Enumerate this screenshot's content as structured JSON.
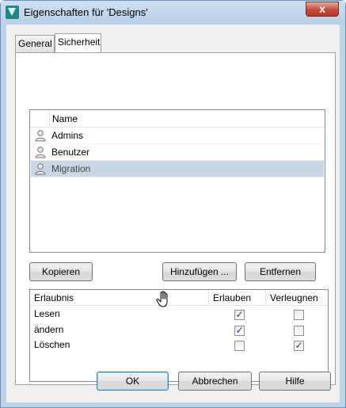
{
  "window": {
    "title": "Eigenschaften für 'Designs'",
    "close_glyph": "x"
  },
  "tabs": [
    {
      "label": "General",
      "active": false
    },
    {
      "label": "Sicherheit",
      "active": true
    }
  ],
  "users_list": {
    "column_header": "Name",
    "items": [
      {
        "label": "Admins",
        "selected": false,
        "icon": "user-icon"
      },
      {
        "label": "Benutzer",
        "selected": false,
        "icon": "user-icon"
      },
      {
        "label": "Migration",
        "selected": true,
        "icon": "user-icon"
      }
    ]
  },
  "list_buttons": {
    "copy": "Kopieren",
    "add": "Hinzufügen ...",
    "remove": "Entfernen"
  },
  "permissions": {
    "headers": {
      "permission": "Erlaubnis",
      "allow": "Erlauben",
      "deny": "Verleugnen"
    },
    "rows": [
      {
        "name": "Lesen",
        "allow": true,
        "deny": false
      },
      {
        "name": "ändern",
        "allow": true,
        "deny": false
      },
      {
        "name": "Löschen",
        "allow": false,
        "deny": true
      }
    ]
  },
  "dialog_buttons": {
    "ok": "OK",
    "cancel": "Abbrechen",
    "help": "Hilfe"
  },
  "colors": {
    "selected_row": "#c7d7e6",
    "close_button": "#c74a37",
    "default_button_border": "#3c7fb1"
  }
}
